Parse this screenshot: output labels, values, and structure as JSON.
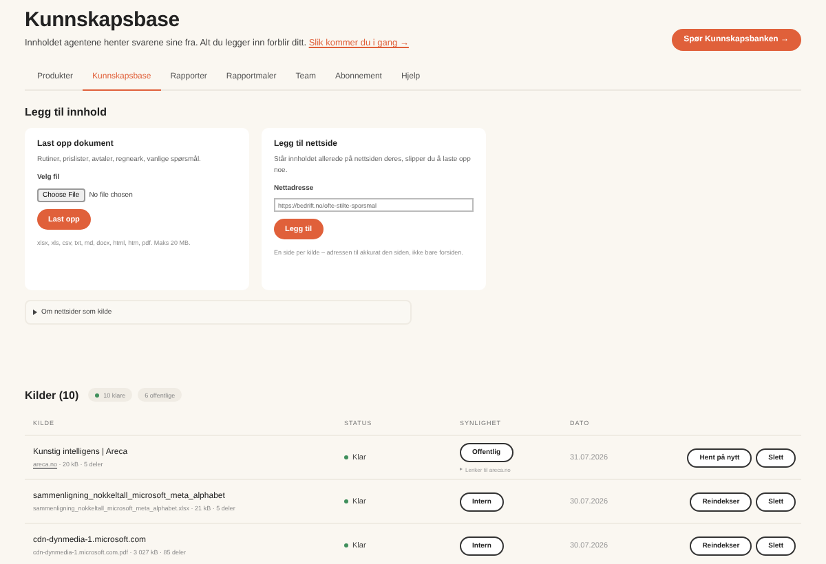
{
  "header": {
    "title": "Kunnskapsbase",
    "subtitle": "Innholdet agentene henter svarene sine fra. Alt du legger inn forblir ditt.",
    "subtitle_link": "Slik kommer du i gang →",
    "ask_button": "Spør Kunnskapsbanken →"
  },
  "tabs": [
    {
      "label": "Produkter",
      "selected": false
    },
    {
      "label": "Kunnskapsbase",
      "selected": true
    },
    {
      "label": "Rapporter",
      "selected": false
    },
    {
      "label": "Rapportmaler",
      "selected": false
    },
    {
      "label": "Team",
      "selected": false
    },
    {
      "label": "Abonnement",
      "selected": false
    },
    {
      "label": "Hjelp",
      "selected": false
    }
  ],
  "add_content": {
    "heading": "Legg til innhold",
    "upload_card": {
      "title": "Last opp dokument",
      "description": "Rutiner, prislister, avtaler, regneark, vanlige spørsmål.",
      "field_label": "Velg fil",
      "file_button": "Choose File",
      "file_status": "No file chosen",
      "submit": "Last opp",
      "hint": "xlsx, xls, csv, txt, md, docx, html, htm, pdf. Maks 20 MB."
    },
    "web_card": {
      "title": "Legg til nettside",
      "description": "Står innholdet allerede på nettsiden deres, slipper du å laste opp noe.",
      "field_label": "Nettadresse",
      "placeholder": "https://bedrift.no/ofte-stilte-sporsmal",
      "submit": "Legg til",
      "hint": "En side per kilde – adressen til akkurat den siden, ikke bare forsiden."
    },
    "disclosure": {
      "label": "Om nettsider som kilde",
      "expanded": false
    }
  },
  "sources": {
    "heading": "Kilder (10)",
    "badges": [
      {
        "label": "10 klare",
        "kind": "status"
      },
      {
        "label": "6 offentlige",
        "kind": "plain"
      }
    ],
    "columns": [
      "KILDE",
      "STATUS",
      "SYNLIGHET",
      "DATO"
    ],
    "rows": [
      {
        "name": "Kunstig intelligens | Areca",
        "source_link": "areca.no",
        "meta": "· 20 kB · 5 deler",
        "status": "Klar",
        "visibility": "Offentlig",
        "visibility_note": "Lenker til areca.no",
        "date": "31.07.2026",
        "actions": [
          "Hent på nytt",
          "Slett"
        ]
      },
      {
        "name": "sammenligning_nokkeltall_microsoft_meta_alphabet",
        "meta": "sammenligning_nokkeltall_microsoft_meta_alphabet.xlsx · 21 kB · 5 deler",
        "status": "Klar",
        "visibility": "Intern",
        "date": "30.07.2026",
        "actions": [
          "Reindekser",
          "Slett"
        ]
      },
      {
        "name": "cdn-dynmedia-1.microsoft.com",
        "meta": "cdn-dynmedia-1.microsoft.com.pdf · 3 027 kB · 85 deler",
        "status": "Klar",
        "visibility": "Intern",
        "date": "30.07.2026",
        "actions": [
          "Reindekser",
          "Slett"
        ]
      }
    ]
  }
}
